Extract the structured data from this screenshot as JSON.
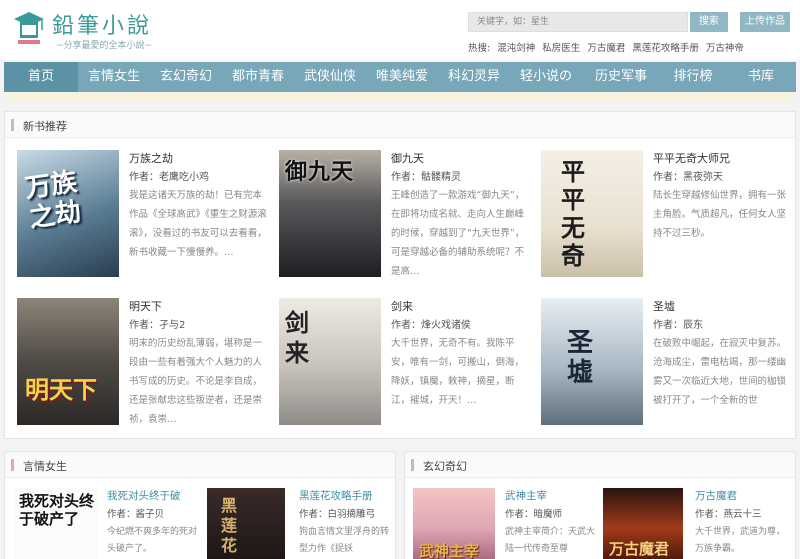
{
  "logo": {
    "title": "鉛筆小說",
    "slogan": "~分享最愛的全本小說~"
  },
  "search": {
    "placeholder": "关键字，如：星生",
    "button": "搜索",
    "upload": "上传作品"
  },
  "hot": {
    "label": "热搜:",
    "items": [
      "混沌剑神",
      "私房医生",
      "万古魔君",
      "黑莲花攻略手册",
      "万古神帝"
    ]
  },
  "nav": [
    "首页",
    "言情女生",
    "玄幻奇幻",
    "都市青春",
    "武侠仙侠",
    "唯美纯爱",
    "科幻灵异",
    "轻小说の",
    "历史军事",
    "排行榜",
    "书库"
  ],
  "new_books": {
    "title": "新书推荐",
    "books": [
      {
        "name": "万族之劫",
        "author": "作者：老鹰吃小鸡",
        "desc": "我是这诸天万族的劫！已有完本作品《全球高武》《重生之财源滚滚》，没看过的书友可以去看看，新书收藏一下慢慢养。…",
        "cover_text": "万族之劫"
      },
      {
        "name": "御九天",
        "author": "作者：骷髅精灵",
        "desc": "王峰创造了一款游戏“御九天”，在即将功成名就、走向人生巅峰的时候，穿越到了“九天世界”，可是穿越必备的辅助系统呢？不是高…",
        "cover_text": "御九天"
      },
      {
        "name": "平平无奇大师兄",
        "author": "作者：黑夜弥天",
        "desc": "陆长生穿越修仙世界，拥有一张主角脸。气质超凡，任何女人坚持不过三秒。",
        "cover_text": "平平无奇"
      },
      {
        "name": "明天下",
        "author": "作者：孑与2",
        "desc": "明末的历史纷乱薄弱，堪称是一段由一些有着强大个人魅力的人书写成的历史。不论是李自成，还是张献忠这些叛逆者，还是崇祯，袁崇…",
        "cover_text": "明天下"
      },
      {
        "name": "剑来",
        "author": "作者：烽火戏诸侯",
        "desc": "大千世界，无奇不有。我陈平安，唯有一剑，可搬山，倒海，降妖，镇魔，敕神，摘星，断江，摧城，开天！…",
        "cover_text": "剑来"
      },
      {
        "name": "圣墟",
        "author": "作者：辰东",
        "desc": "在破败中崛起，在寂灭中复苏。沧海成尘，雷电枯竭，那一缕幽雾又一次临近大地，世间的枷锁被打开了，一个全新的世",
        "cover_text": "圣墟"
      }
    ]
  },
  "romance": {
    "title": "言情女生",
    "books": [
      {
        "name": "我死对头终于破",
        "author": "作者：酱子贝",
        "desc": "今纪燃不爽多年的死对头破产了。",
        "cover_text": "我死对头终于破产了"
      },
      {
        "name": "黑莲花攻略手册",
        "author": "作者：白羽摘雕弓",
        "desc": "狗血言情文里浮舟的转型力作《捉妖",
        "cover_text": "黑莲花"
      }
    ]
  },
  "fantasy": {
    "title": "玄幻奇幻",
    "books": [
      {
        "name": "武神主宰",
        "author": "作者：暗魔师",
        "desc": "武神主宰简介：天武大陆一代传奇至尊",
        "cover_text": "武神主宰"
      },
      {
        "name": "万古魔君",
        "author": "作者：燕云十三",
        "desc": "大千世界，武道为尊，万族争霸。",
        "cover_text": "万古魔君"
      }
    ]
  },
  "colors": {
    "nav": "#77a7b8",
    "nav_active": "#5b92a6",
    "accent": "#3f8ea6",
    "logo": "#3a9a9a"
  }
}
